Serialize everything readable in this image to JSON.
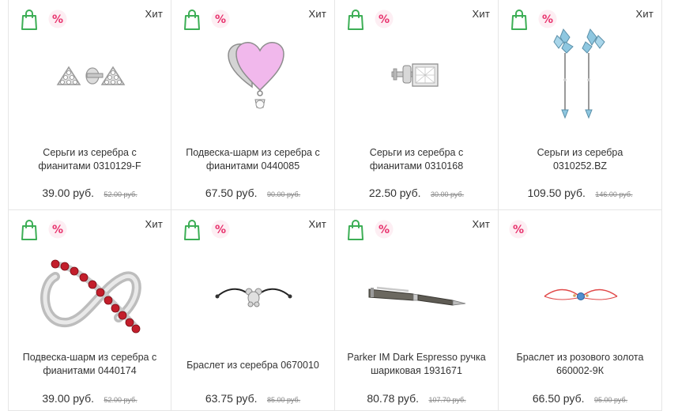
{
  "products": [
    {
      "title_line1": "Серьги из серебра с",
      "title_line2": "фианитами 0310129-F",
      "price": "39.00 руб.",
      "old_price": "52.00 руб.",
      "badge": "Хит",
      "cart_icon": "shopping-bag-icon",
      "sale_icon": "percent-icon"
    },
    {
      "title_line1": "Подвеска-шарм из серебра с",
      "title_line2": "фианитами 0440085",
      "price": "67.50 руб.",
      "old_price": "90.00 руб.",
      "badge": "Хит",
      "cart_icon": "shopping-bag-icon",
      "sale_icon": "percent-icon"
    },
    {
      "title_line1": "Серьги из серебра с",
      "title_line2": "фианитами 0310168",
      "price": "22.50 руб.",
      "old_price": "30.00 руб.",
      "badge": "Хит",
      "cart_icon": "shopping-bag-icon",
      "sale_icon": "percent-icon"
    },
    {
      "title_line1": "Серьги из серебра",
      "title_line2": "0310252.BZ",
      "price": "109.50 руб.",
      "old_price": "146.00 руб.",
      "badge": "Хит",
      "cart_icon": "shopping-bag-icon",
      "sale_icon": "percent-icon"
    },
    {
      "title_line1": "Подвеска-шарм из серебра с",
      "title_line2": "фианитами 0440174",
      "price": "39.00 руб.",
      "old_price": "52.00 руб.",
      "badge": "Хит",
      "cart_icon": "shopping-bag-icon",
      "sale_icon": "percent-icon"
    },
    {
      "title_line1": "Браслет из серебра 0670010",
      "title_line2": "",
      "price": "63.75 руб.",
      "old_price": "85.00 руб.",
      "badge": "Хит",
      "cart_icon": "shopping-bag-icon",
      "sale_icon": "percent-icon"
    },
    {
      "title_line1": "Parker IM Dark Espresso ручка",
      "title_line2": "шариковая 1931671",
      "price": "80.78 руб.",
      "old_price": "107.70 руб.",
      "badge": "Хит",
      "cart_icon": "shopping-bag-icon",
      "sale_icon": "percent-icon"
    },
    {
      "title_line1": "Браслет из розового золота",
      "title_line2": "660002-9К",
      "price": "66.50 руб.",
      "old_price": "95.00 руб.",
      "badge": "",
      "cart_icon": "",
      "sale_icon": "percent-icon"
    }
  ],
  "colors": {
    "cart_green": "#3cae55",
    "sale_pink": "#e8336e",
    "sale_bg": "#fdeef3"
  }
}
